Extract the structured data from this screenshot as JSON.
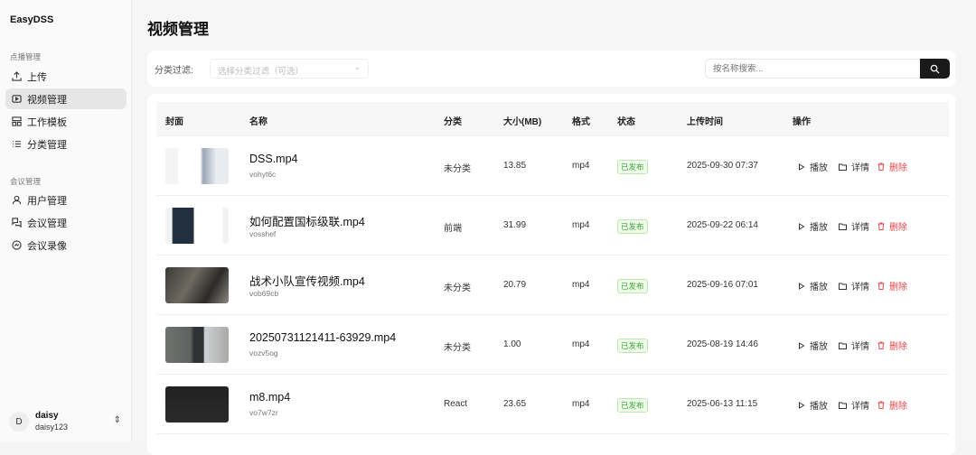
{
  "app": {
    "brand": "EasyDSS"
  },
  "sidebar": {
    "group1": "点播管理",
    "group2": "会议管理",
    "items": [
      {
        "label": "上传",
        "icon": "upload-icon"
      },
      {
        "label": "视频管理",
        "icon": "video-icon"
      },
      {
        "label": "工作模板",
        "icon": "template-icon"
      },
      {
        "label": "分类管理",
        "icon": "list-icon"
      },
      {
        "label": "用户管理",
        "icon": "user-icon"
      },
      {
        "label": "会议管理",
        "icon": "meeting-icon"
      },
      {
        "label": "会议录像",
        "icon": "record-icon"
      }
    ],
    "user": {
      "initial": "D",
      "name": "daisy",
      "account": "daisy123"
    }
  },
  "page": {
    "title": "视频管理"
  },
  "filter": {
    "label": "分类过滤:",
    "select_placeholder": "选择分类过滤（可选）",
    "search_placeholder": "按名称搜索..."
  },
  "table": {
    "headers": [
      "封面",
      "名称",
      "分类",
      "大小(MB)",
      "格式",
      "状态",
      "上传时间",
      "操作"
    ],
    "actions": {
      "play": "播放",
      "detail": "详情",
      "delete": "删除"
    },
    "rows": [
      {
        "name": "DSS.mp4",
        "id": "vohyt6c",
        "category": "未分类",
        "size": "13.85",
        "format": "mp4",
        "status": "已发布",
        "time": "2025-09-30 07:37"
      },
      {
        "name": "如何配置国标级联.mp4",
        "id": "vosshef",
        "category": "前端",
        "size": "31.99",
        "format": "mp4",
        "status": "已发布",
        "time": "2025-09-22 06:14"
      },
      {
        "name": "战术小队宣传视频.mp4",
        "id": "vob69cb",
        "category": "未分类",
        "size": "20.79",
        "format": "mp4",
        "status": "已发布",
        "time": "2025-09-16 07:01"
      },
      {
        "name": "20250731121411-63929.mp4",
        "id": "vozv5og",
        "category": "未分类",
        "size": "1.00",
        "format": "mp4",
        "status": "已发布",
        "time": "2025-08-19 14:46"
      },
      {
        "name": "m8.mp4",
        "id": "vo7w7zr",
        "category": "React",
        "size": "23.65",
        "format": "mp4",
        "status": "已发布",
        "time": "2025-06-13 11:15"
      }
    ]
  },
  "colors": {
    "accent": "#1a1a1a",
    "danger": "#e5484d",
    "success": "#3aa53a"
  }
}
